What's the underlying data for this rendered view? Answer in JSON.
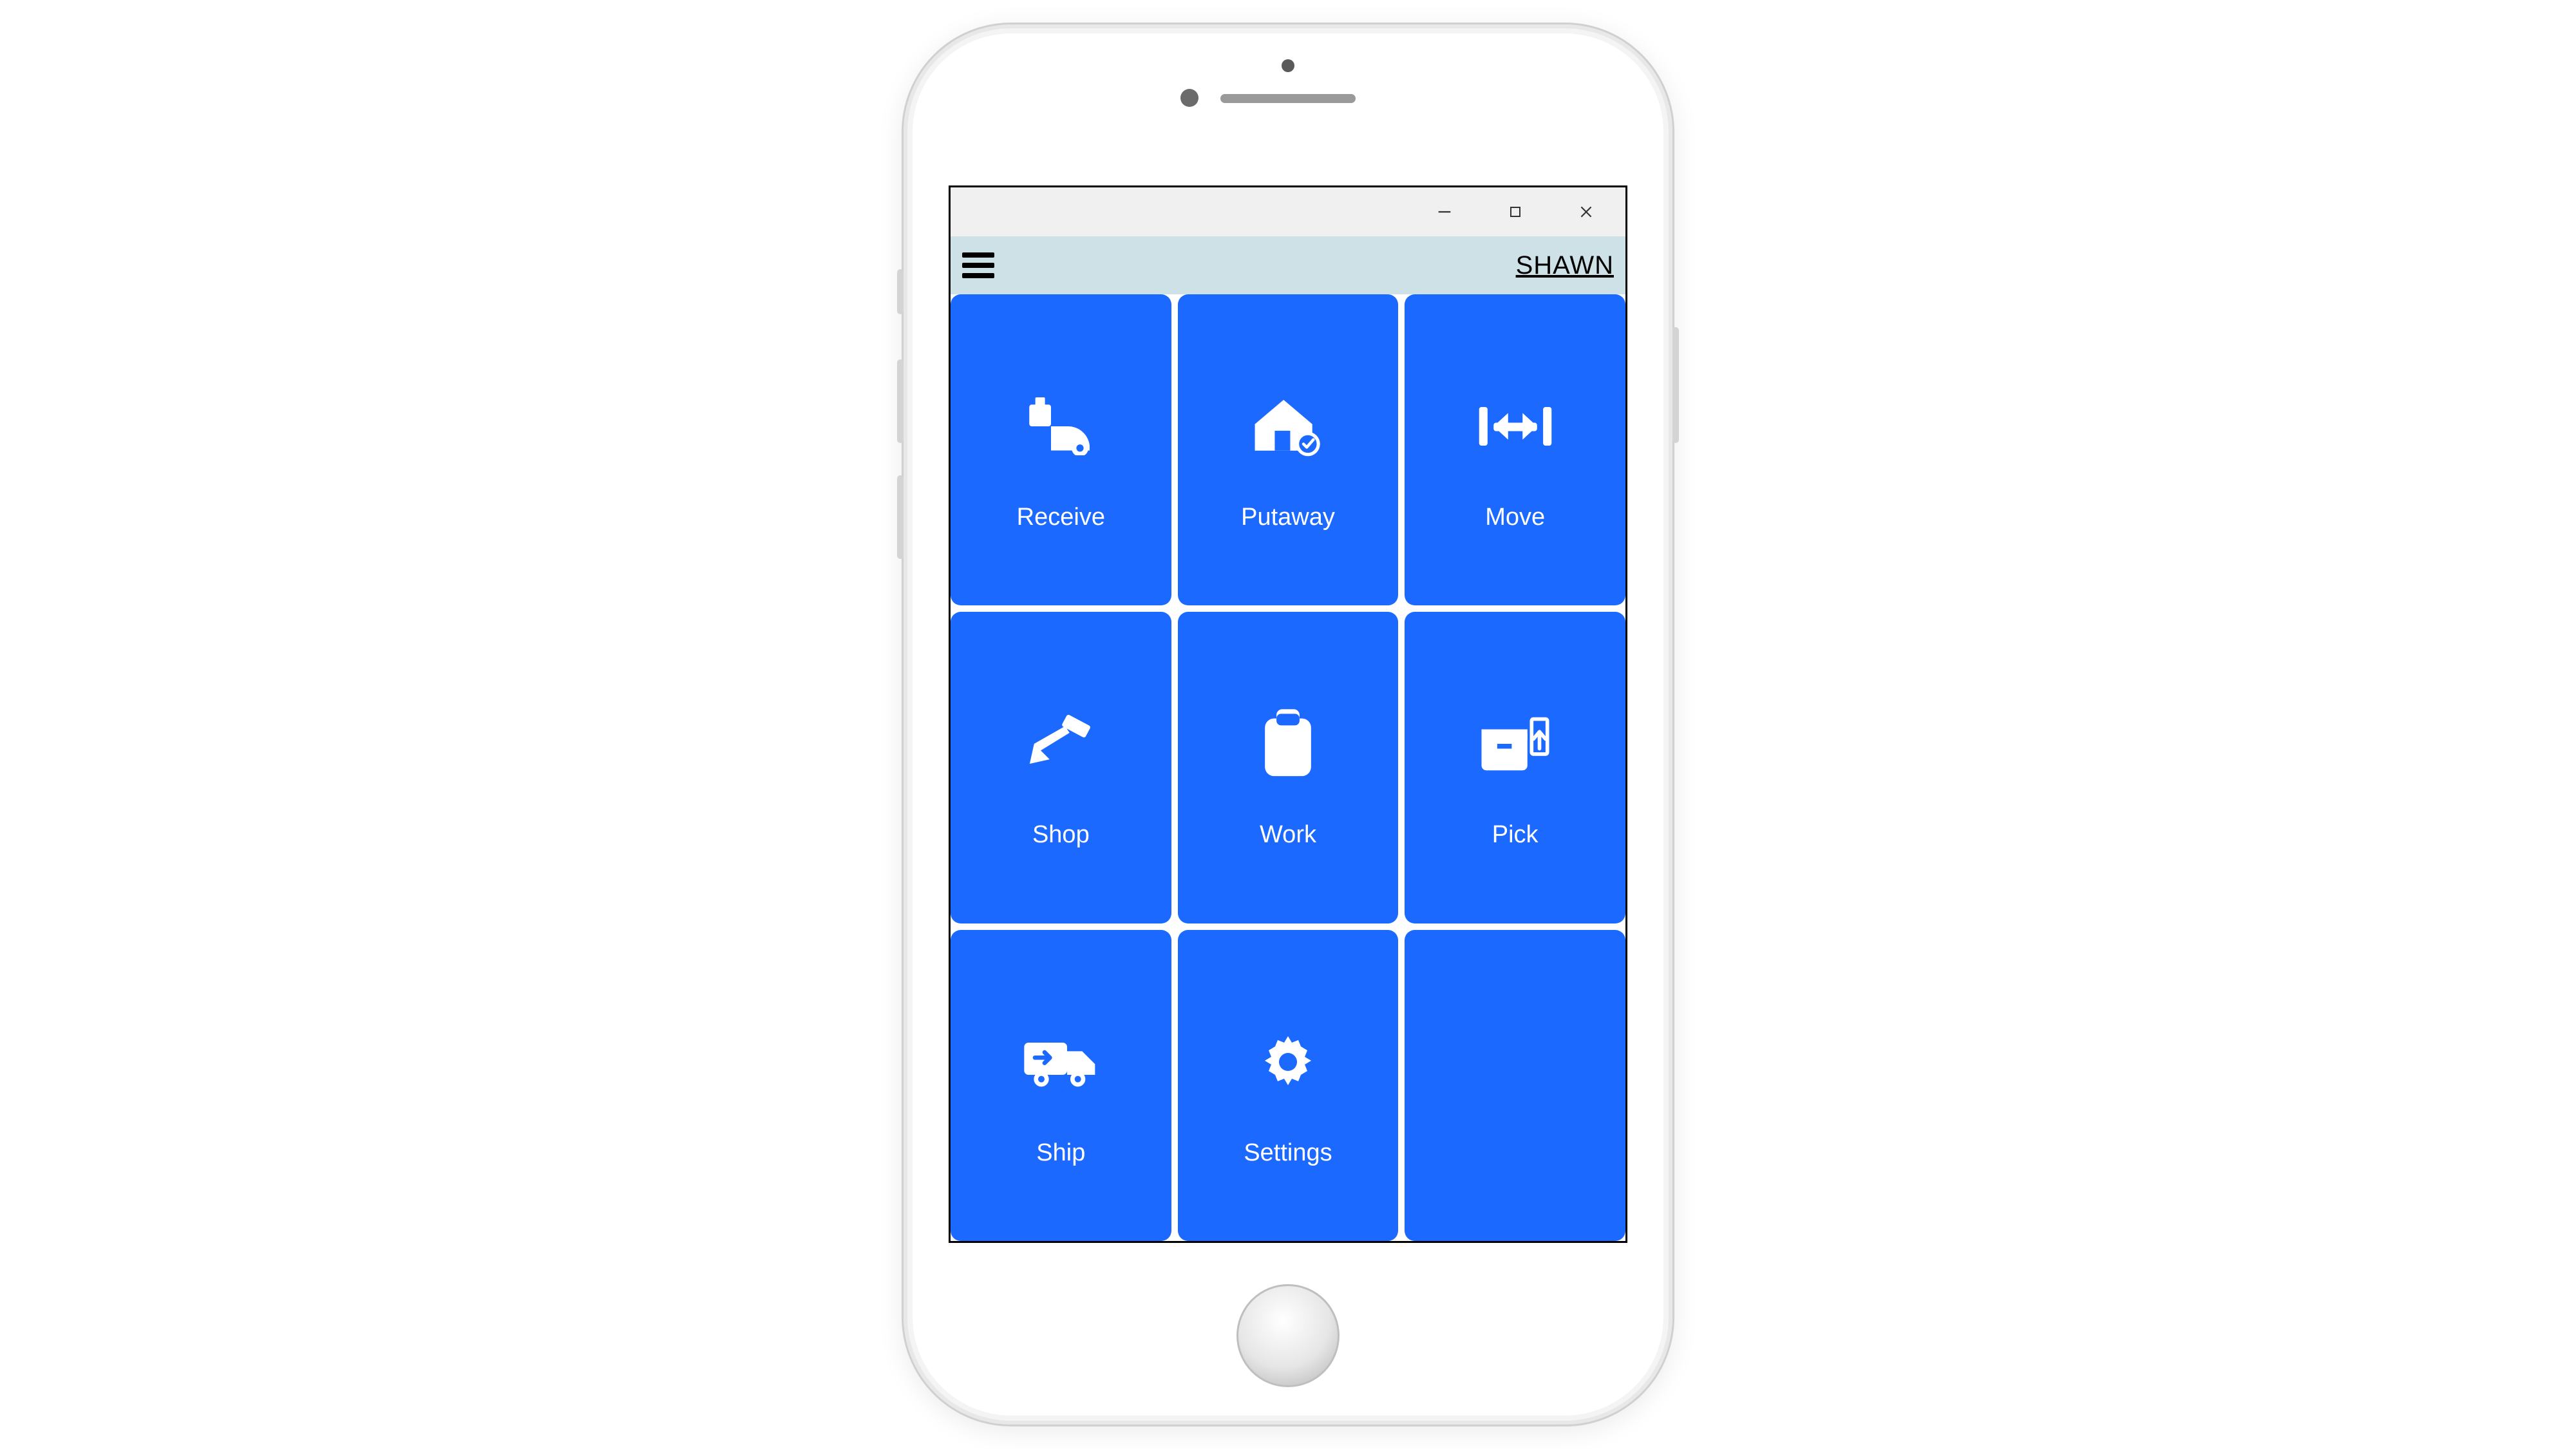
{
  "header": {
    "user": "SHAWN"
  },
  "tiles": [
    {
      "label": "Receive",
      "icon": "receive-icon"
    },
    {
      "label": "Putaway",
      "icon": "putaway-icon"
    },
    {
      "label": "Move",
      "icon": "move-icon"
    },
    {
      "label": "Shop",
      "icon": "shop-icon"
    },
    {
      "label": "Work",
      "icon": "work-icon"
    },
    {
      "label": "Pick",
      "icon": "pick-icon"
    },
    {
      "label": "Ship",
      "icon": "ship-icon"
    },
    {
      "label": "Settings",
      "icon": "settings-icon"
    }
  ],
  "colors": {
    "tile": "#1c69ff",
    "header": "#cde1e6",
    "titlebar": "#f0f0f0"
  }
}
